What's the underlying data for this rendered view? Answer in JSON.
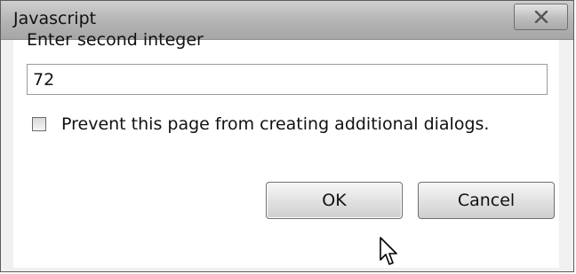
{
  "window": {
    "title": "Javascript",
    "close_glyph": "X"
  },
  "prompt": {
    "label": "Enter second integer",
    "value": "72"
  },
  "checkbox": {
    "label": "Prevent this page from creating additional dialogs.",
    "checked": false
  },
  "buttons": {
    "ok_label": "OK",
    "cancel_label": "Cancel"
  },
  "icons": {
    "close": "close-icon",
    "pointer": "mouse-pointer-icon"
  }
}
